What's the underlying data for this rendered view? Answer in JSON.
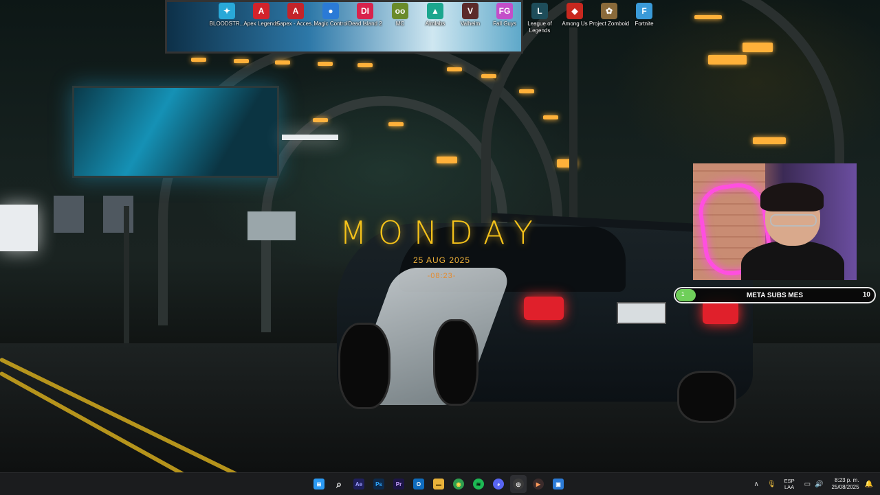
{
  "desktop": {
    "icons": [
      {
        "label": "BLOODSTR...",
        "name": "bloodstrike-shortcut",
        "glyph": "✦",
        "color": "#29a8d8"
      },
      {
        "label": "Apex Legends",
        "name": "apex-legends-shortcut",
        "glyph": "A",
        "color": "#d3232b"
      },
      {
        "label": "r5apex - Acces...",
        "name": "r5apex-shortcut",
        "glyph": "A",
        "color": "#c4242a"
      },
      {
        "label": "Magic Control",
        "name": "magic-control-shortcut",
        "glyph": "●",
        "color": "#2b7ad6"
      },
      {
        "label": "Dead Island 2",
        "name": "dead-island-2-shortcut",
        "glyph": "DI",
        "color": "#d8234c"
      },
      {
        "label": "MC",
        "name": "mc-shortcut",
        "glyph": "oo",
        "color": "#6a8b2a"
      },
      {
        "label": "Aimlabs",
        "name": "aimlabs-shortcut",
        "glyph": "▲",
        "color": "#1ba68e"
      },
      {
        "label": "Valheim",
        "name": "valheim-shortcut",
        "glyph": "V",
        "color": "#5b2a2a"
      },
      {
        "label": "Fall Guys",
        "name": "fall-guys-shortcut",
        "glyph": "FG",
        "color": "#c34fc9"
      },
      {
        "label": "League of Legends",
        "name": "league-of-legends-shortcut",
        "glyph": "L",
        "color": "#1e4d5a"
      },
      {
        "label": "Among Us",
        "name": "among-us-shortcut",
        "glyph": "◆",
        "color": "#c8281f"
      },
      {
        "label": "Project Zomboid",
        "name": "project-zomboid-shortcut",
        "glyph": "✿",
        "color": "#8a6a3a"
      },
      {
        "label": "Fortnite",
        "name": "fortnite-shortcut",
        "glyph": "F",
        "color": "#3a9ad8"
      }
    ]
  },
  "widget": {
    "day": "MONDAY",
    "date": "25 AUG 2025",
    "time": "-08:23-"
  },
  "sub_goal": {
    "current": "1",
    "label": "META SUBS MES",
    "target": "10",
    "progress": 0.1,
    "color": "#6fcf5a"
  },
  "taskbar": {
    "apps": [
      {
        "name": "start-button",
        "glyph": "⊞",
        "color": "#2b9af3"
      },
      {
        "name": "search-button",
        "glyph": "⌕",
        "color": "transparent"
      },
      {
        "name": "after-effects-app",
        "glyph": "Ae",
        "color": "#1f1f5c"
      },
      {
        "name": "photoshop-app",
        "glyph": "Ps",
        "color": "#0d2a4a"
      },
      {
        "name": "premiere-app",
        "glyph": "Pr",
        "color": "#1d1547"
      },
      {
        "name": "outlook-app",
        "glyph": "O",
        "color": "#0f6cbd"
      },
      {
        "name": "file-explorer-app",
        "glyph": "▬",
        "color": "#e8b23a"
      },
      {
        "name": "chrome-app",
        "glyph": "◉",
        "color": "#2e9e4f"
      },
      {
        "name": "spotify-app",
        "glyph": "≋",
        "color": "#1db954"
      },
      {
        "name": "discord-app",
        "glyph": "◕",
        "color": "#5865f2"
      },
      {
        "name": "obs-app",
        "glyph": "◎",
        "color": "#3a3a3a"
      },
      {
        "name": "media-player-app",
        "glyph": "▶",
        "color": "#e05a1a"
      },
      {
        "name": "photos-app",
        "glyph": "▣",
        "color": "#2c7bd6"
      }
    ],
    "language_top": "ESP",
    "language_bottom": "LAA",
    "clock_time": "8:23 p. m.",
    "clock_date": "25/08/2025"
  }
}
